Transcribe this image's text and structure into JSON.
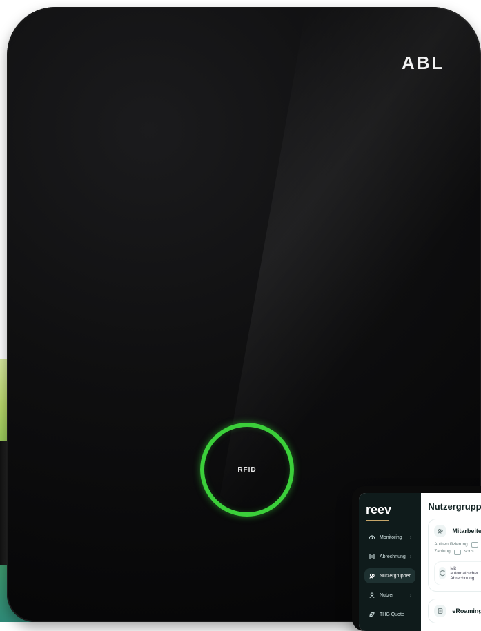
{
  "brand": {
    "logo_text": "ABL",
    "rfid_label": "RFID"
  },
  "tablet_ui": {
    "app_name": "reev",
    "nav": [
      {
        "label": "Monitoring",
        "icon": "gauge-icon",
        "active": false
      },
      {
        "label": "Abrechnung",
        "icon": "receipt-icon",
        "active": false
      },
      {
        "label": "Nutzergruppen",
        "icon": "users-icon",
        "active": true
      },
      {
        "label": "Nutzer",
        "icon": "user-icon",
        "active": false
      },
      {
        "label": "THG Quote",
        "icon": "leaf-icon",
        "active": false
      }
    ],
    "page_title": "Nutzergruppen",
    "cards": [
      {
        "title": "Mitarbeiter",
        "auth_label": "Authentifizierung",
        "payment_label": "Zahlung",
        "payment_value": "sons",
        "sub_label": "Mit automatischer Abrechnung"
      },
      {
        "title": "eRoaming"
      }
    ]
  },
  "colors": {
    "rfid_green": "#3bcf3a",
    "charger_black": "#0f0f10",
    "sidebar_dark": "#0f1b1b",
    "accent_gold": "#c7a76a",
    "bg_green_gradient": [
      "#d7e8a0",
      "#7bbb4a",
      "#2f8a78"
    ]
  }
}
